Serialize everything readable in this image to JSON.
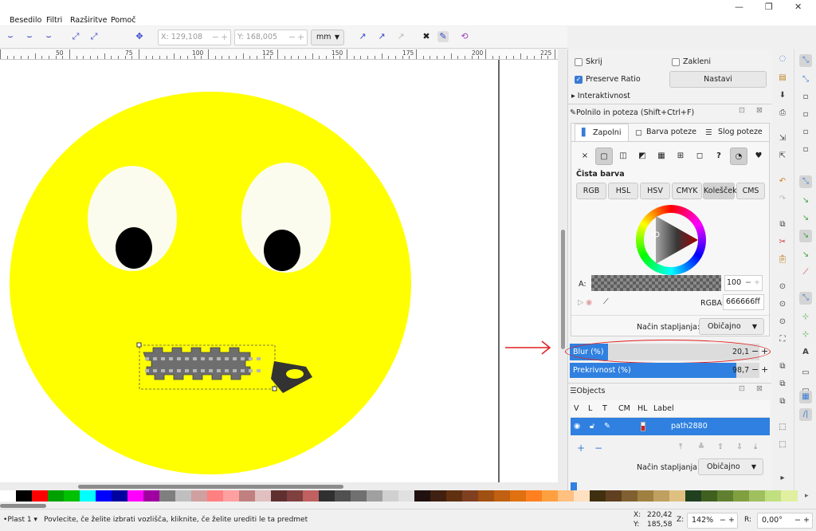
{
  "menu": [
    "Besedilo",
    "Filtri",
    "Razširitve",
    "Pomoč"
  ],
  "window_controls": [
    "—",
    "❐",
    "✕"
  ],
  "toolbar": {
    "x_label": "X:",
    "x_value": "129,108",
    "y_label": "Y:",
    "y_value": "168,005",
    "unit": "mm"
  },
  "ruler": {
    "labels": [
      "50",
      "75",
      "100",
      "125",
      "150",
      "175",
      "200",
      "225"
    ]
  },
  "dock": {
    "checkbox_skrij": "Skrij",
    "checkbox_zakleni": "Zakleni",
    "checkbox_preserve": "Preserve Ratio",
    "nastavi": "Nastavi",
    "interaktivnost": "Interaktivnost",
    "fill_title": "Polnilo in poteza  (Shift+Ctrl+F)",
    "tabs": [
      "Zapolni",
      "Barva poteze",
      "Slog poteze"
    ],
    "paint_x": "×",
    "paint_unknown": "?",
    "flat_color": "Čista barva",
    "color_modes": [
      "RGB",
      "HSL",
      "HSV",
      "CMYK",
      "Kolešček",
      "CMS"
    ],
    "alpha_label": "A:",
    "alpha_value": "100",
    "rgba_label": "RGBA:",
    "rgba_value": "666666ff",
    "blend_label": "Način stapljanja:",
    "blend_value": "Običajno",
    "blur_label": "Blur (%)",
    "blur_value": "20,1",
    "blur_fraction": 0.201,
    "opacity_label": "Prekrivnost (%)",
    "opacity_value": "98,7",
    "opacity_fraction": 0.987,
    "objects_title": "Objects",
    "objects_cols": [
      "V",
      "L",
      "T",
      "CM",
      "HL",
      "Label"
    ],
    "objects_row_label": "path2880",
    "objects_blend_label": "Način stapljanja:",
    "objects_blend_value": "Običajno"
  },
  "status": {
    "layer": "Plast 1",
    "message": "Povlecite, če želite izbrati vozlišča, kliknite, če želite urediti le ta predmet",
    "x_label": "X:",
    "x_value": "220,42",
    "y_label": "Y:",
    "y_value": "185,58",
    "zoom_label": "Z:",
    "zoom_value": "142%",
    "rot_label": "R:",
    "rot_value": "0,00°"
  },
  "colors": {
    "accent": "#3a7bd5",
    "smiley": "#ffff00",
    "annotation": "#e02020",
    "selection": "#2f80e0"
  },
  "palette": [
    "#ffffff",
    "#000000",
    "#ff0000",
    "#00a000",
    "#00c000",
    "#00ffff",
    "#0000ff",
    "#0000a0",
    "#ff00ff",
    "#a000a0",
    "#7f7f7f",
    "#bfbfbf",
    "#d0a0a0",
    "#ff8080",
    "#ffa0a0",
    "#c08080",
    "#e0c0c0",
    "#603030",
    "#804040",
    "#c06060",
    "#303030",
    "#505050",
    "#707070",
    "#a0a0a0",
    "#d0d0d0",
    "#e0e0e0",
    "#201010",
    "#402010",
    "#603010",
    "#804020",
    "#a05010",
    "#c06010",
    "#e07010",
    "#ff8020",
    "#ffa040",
    "#ffc080",
    "#ffe0c0",
    "#403010",
    "#604020",
    "#806030",
    "#a08040",
    "#c0a060",
    "#e0c080",
    "#204020",
    "#406020",
    "#608030",
    "#80a040",
    "#a0c060",
    "#c0e080",
    "#e0f0a0"
  ]
}
